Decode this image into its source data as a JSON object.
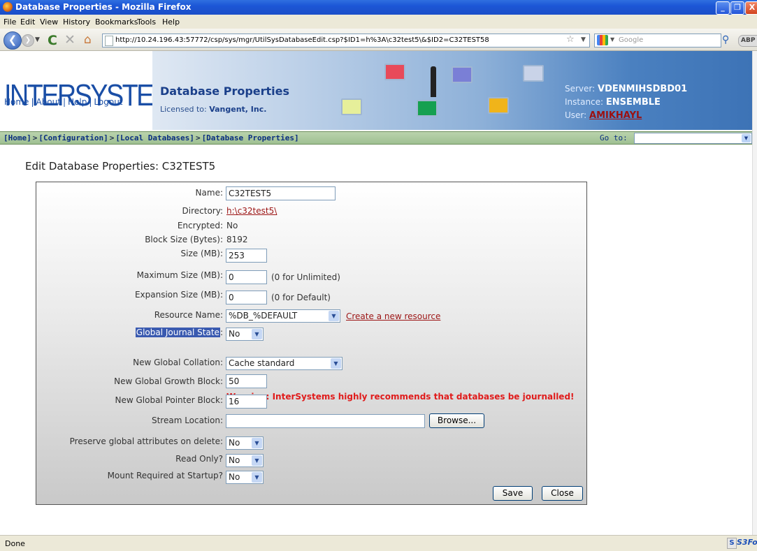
{
  "window": {
    "title": "Database Properties - Mozilla Firefox",
    "controls": [
      "_",
      "❐",
      "X"
    ]
  },
  "menu": [
    "File",
    "Edit",
    "View",
    "History",
    "Bookmarks",
    "Tools",
    "Help"
  ],
  "nav": {
    "url": "http://10.24.196.43:57772/csp/sys/mgr/UtilSysDatabaseEdit.csp?$ID1=h%3A\\c32test5\\&$ID2=C32TEST58",
    "search_placeholder": "Google",
    "addon": "ABP"
  },
  "header": {
    "logo": "INTERSYSTEMS",
    "links": [
      "Home",
      "About",
      "Help",
      "Logout"
    ],
    "title": "Database Properties",
    "license_label": "Licensed to:",
    "license_value": "Vangent, Inc.",
    "server_label": "Server:",
    "server_value": "VDENMIHSDBD01",
    "instance_label": "Instance:",
    "instance_value": "ENSEMBLE",
    "user_label": "User:",
    "user_value": "AMIKHAYL"
  },
  "breadcrumb": [
    "[Home]",
    "[Configuration]",
    "[Local Databases]",
    "[Database Properties]"
  ],
  "goto": {
    "label": "Go to:",
    "value": ""
  },
  "page_heading": "Edit Database Properties: C32TEST5",
  "form": {
    "name": {
      "label": "Name:",
      "value": "C32TEST5"
    },
    "directory": {
      "label": "Directory:",
      "value": "h:\\c32test5\\"
    },
    "encrypted": {
      "label": "Encrypted:",
      "value": "No"
    },
    "block_size": {
      "label": "Block Size (Bytes):",
      "value": "8192"
    },
    "size": {
      "label": "Size (MB):",
      "value": "253"
    },
    "max_size": {
      "label": "Maximum Size (MB):",
      "value": "0",
      "hint": "(0 for Unlimited)"
    },
    "expansion_size": {
      "label": "Expansion Size (MB):",
      "value": "0",
      "hint": "(0 for Default)"
    },
    "resource_name": {
      "label": "Resource Name:",
      "value": "%DB_%DEFAULT",
      "link": "Create a new resource"
    },
    "global_journal_state": {
      "label": "Global Journal State",
      "value": "No"
    },
    "warning": "Warning: InterSystems highly recommends that databases be journalled!",
    "new_global_collation": {
      "label": "New Global Collation:",
      "value": "Cache standard"
    },
    "new_global_growth_block": {
      "label": "New Global Growth Block:",
      "value": "50"
    },
    "new_global_pointer_block": {
      "label": "New Global Pointer Block:",
      "value": "16"
    },
    "stream_location": {
      "label": "Stream Location:",
      "value": "",
      "browse": "Browse..."
    },
    "preserve_global_attributes": {
      "label": "Preserve global attributes on delete:",
      "value": "No"
    },
    "read_only": {
      "label": "Read Only?",
      "value": "No"
    },
    "mount_required": {
      "label": "Mount Required at Startup?",
      "value": "No"
    },
    "save": "Save",
    "close": "Close"
  },
  "status": {
    "text": "Done",
    "addon": "S3Fo"
  }
}
